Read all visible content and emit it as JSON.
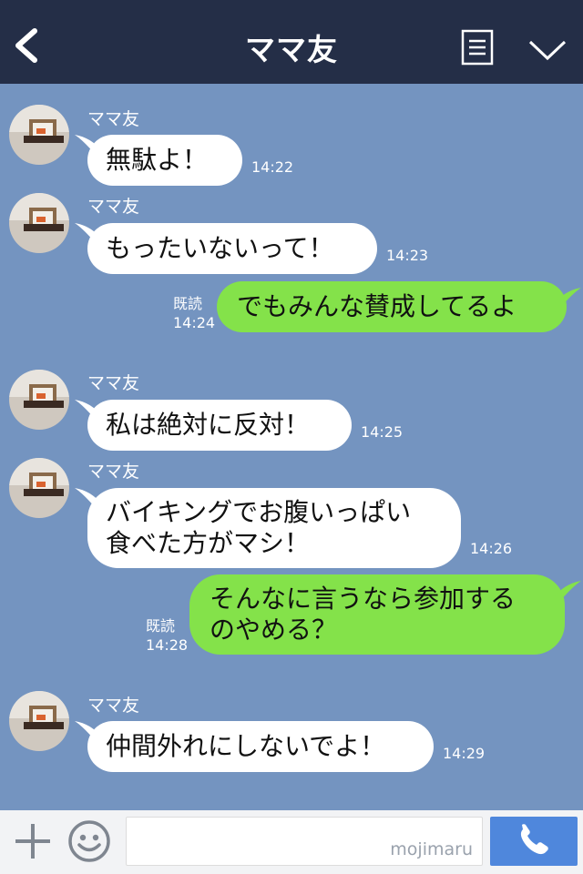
{
  "header": {
    "title": "ママ友"
  },
  "messages": [
    {
      "dir": "in",
      "sender": "ママ友",
      "text": "無駄よ！",
      "time": "14:22"
    },
    {
      "dir": "in",
      "sender": "ママ友",
      "text": "もったいないって！",
      "time": "14:23"
    },
    {
      "dir": "out",
      "read": "既読",
      "text": "でもみんな賛成してるよ",
      "time": "14:24"
    },
    {
      "dir": "in",
      "sender": "ママ友",
      "text": "私は絶対に反対！",
      "time": "14:25"
    },
    {
      "dir": "in",
      "sender": "ママ友",
      "text": "バイキングでお腹いっぱい\n食べた方がマシ！",
      "time": "14:26"
    },
    {
      "dir": "out",
      "read": "既読",
      "text": "そんなに言うなら参加する\nのやめる？",
      "time": "14:28"
    },
    {
      "dir": "in",
      "sender": "ママ友",
      "text": "仲間外れにしないでよ！",
      "time": "14:29"
    }
  ],
  "footer": {
    "watermark": "mojimaru"
  },
  "colors": {
    "header_bg": "#242e47",
    "chat_bg": "#7494c0",
    "outgoing_bubble": "#84e24a",
    "incoming_bubble": "#ffffff",
    "send_button": "#4f87dc"
  },
  "icons": {
    "back": "chevron-left-icon",
    "menu": "list-icon",
    "collapse": "chevron-down-icon",
    "plus": "plus-icon",
    "emoji": "smiley-icon",
    "call": "phone-icon"
  }
}
